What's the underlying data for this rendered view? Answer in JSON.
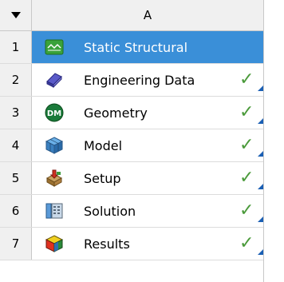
{
  "table": {
    "column_header": "A",
    "rows": [
      {
        "num": "1",
        "label": "Static Structural",
        "icon": "static-structural-icon",
        "check": ""
      },
      {
        "num": "2",
        "label": "Engineering Data",
        "icon": "engineering-data-icon",
        "check": "✓"
      },
      {
        "num": "3",
        "label": "Geometry",
        "icon": "geometry-dm-icon",
        "check": "✓"
      },
      {
        "num": "4",
        "label": "Model",
        "icon": "model-icon",
        "check": "✓"
      },
      {
        "num": "5",
        "label": "Setup",
        "icon": "setup-icon",
        "check": "✓"
      },
      {
        "num": "6",
        "label": "Solution",
        "icon": "solution-icon",
        "check": "✓"
      },
      {
        "num": "7",
        "label": "Results",
        "icon": "results-icon",
        "check": "✓"
      }
    ]
  },
  "colors": {
    "selected_row": "#3a8fd8",
    "check": "#4a9a3a"
  }
}
